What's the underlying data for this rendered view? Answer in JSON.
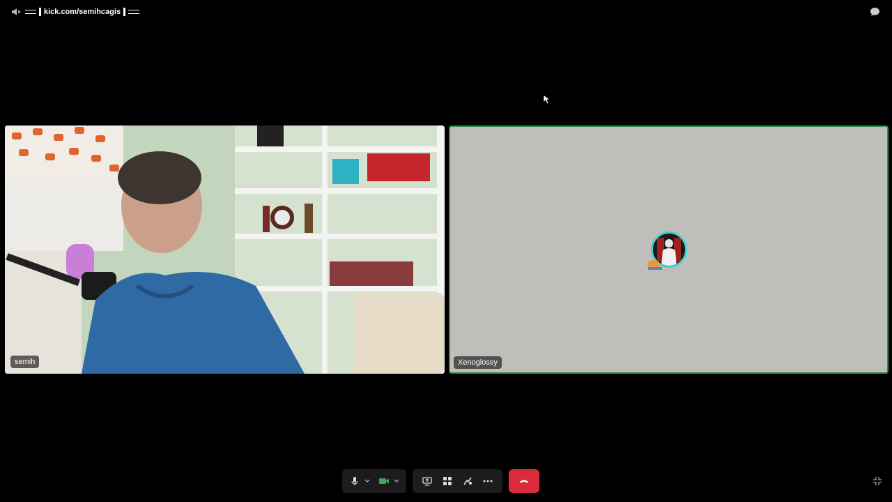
{
  "topbar": {
    "channel_text": "kick.com/semihcagis",
    "speaker_icon": "speaker-muted-icon",
    "chat_icon": "chat-bubble-icon"
  },
  "participants": [
    {
      "name": "semih",
      "video": "camera-feed"
    },
    {
      "name": "Xenoglossy",
      "video": "avatar-only"
    }
  ],
  "controls": {
    "mic_icon": "microphone-icon",
    "camera_icon": "camera-icon",
    "share_icon": "screen-share-icon",
    "activities_icon": "activities-icon",
    "effects_icon": "soundboard-icon",
    "more_icon": "more-icon",
    "end_icon": "hang-up-icon",
    "fullscreen_icon": "exit-fullscreen-icon"
  },
  "colors": {
    "background": "#000000",
    "speaking_border": "#2f8f46",
    "end_call": "#d92b3a",
    "camera_on": "#3ba55d"
  }
}
